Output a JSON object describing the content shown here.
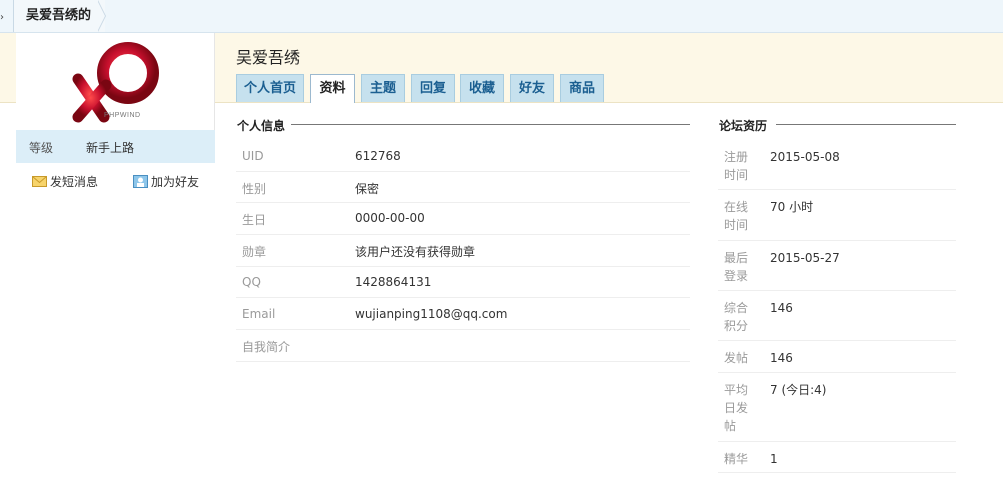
{
  "breadcrumb": {
    "current": "吴爱吾绣的"
  },
  "profile": {
    "name": "吴爱吾绣",
    "logo_text": "PHPWIND",
    "level_label": "等级",
    "level_value": "新手上路",
    "actions": {
      "message": "发短消息",
      "add_friend": "加为好友"
    }
  },
  "tabs": [
    {
      "label": "个人首页"
    },
    {
      "label": "资料",
      "active": true
    },
    {
      "label": "主题"
    },
    {
      "label": "回复"
    },
    {
      "label": "收藏"
    },
    {
      "label": "好友"
    },
    {
      "label": "商品"
    }
  ],
  "personal_info": {
    "title": "个人信息",
    "rows": [
      {
        "key": "UID",
        "value": "612768"
      },
      {
        "key": "性别",
        "value": "保密"
      },
      {
        "key": "生日",
        "value": "0000-00-00"
      },
      {
        "key": "勋章",
        "value": "该用户还没有获得勋章"
      },
      {
        "key": "QQ",
        "value": "1428864131"
      },
      {
        "key": "Email",
        "value": "wujianping1108@qq.com"
      },
      {
        "key": "自我简介",
        "value": ""
      }
    ]
  },
  "forum_history": {
    "title": "论坛资历",
    "rows": [
      {
        "key": "注册时间",
        "value": "2015-05-08"
      },
      {
        "key": "在线时间",
        "value": "70 小时"
      },
      {
        "key": "最后登录",
        "value": "2015-05-27"
      },
      {
        "key": "综合积分",
        "value": "146"
      },
      {
        "key": "发帖",
        "value": "146"
      },
      {
        "key": "平均日发帖",
        "value": "7 (今日:4)"
      },
      {
        "key": "精华",
        "value": "1"
      }
    ]
  },
  "colors": {
    "brand_red": "#c8102e",
    "tab_bg": "#c6e1ee",
    "tab_text": "#1b5f91",
    "header_band": "#fdf8e7"
  }
}
